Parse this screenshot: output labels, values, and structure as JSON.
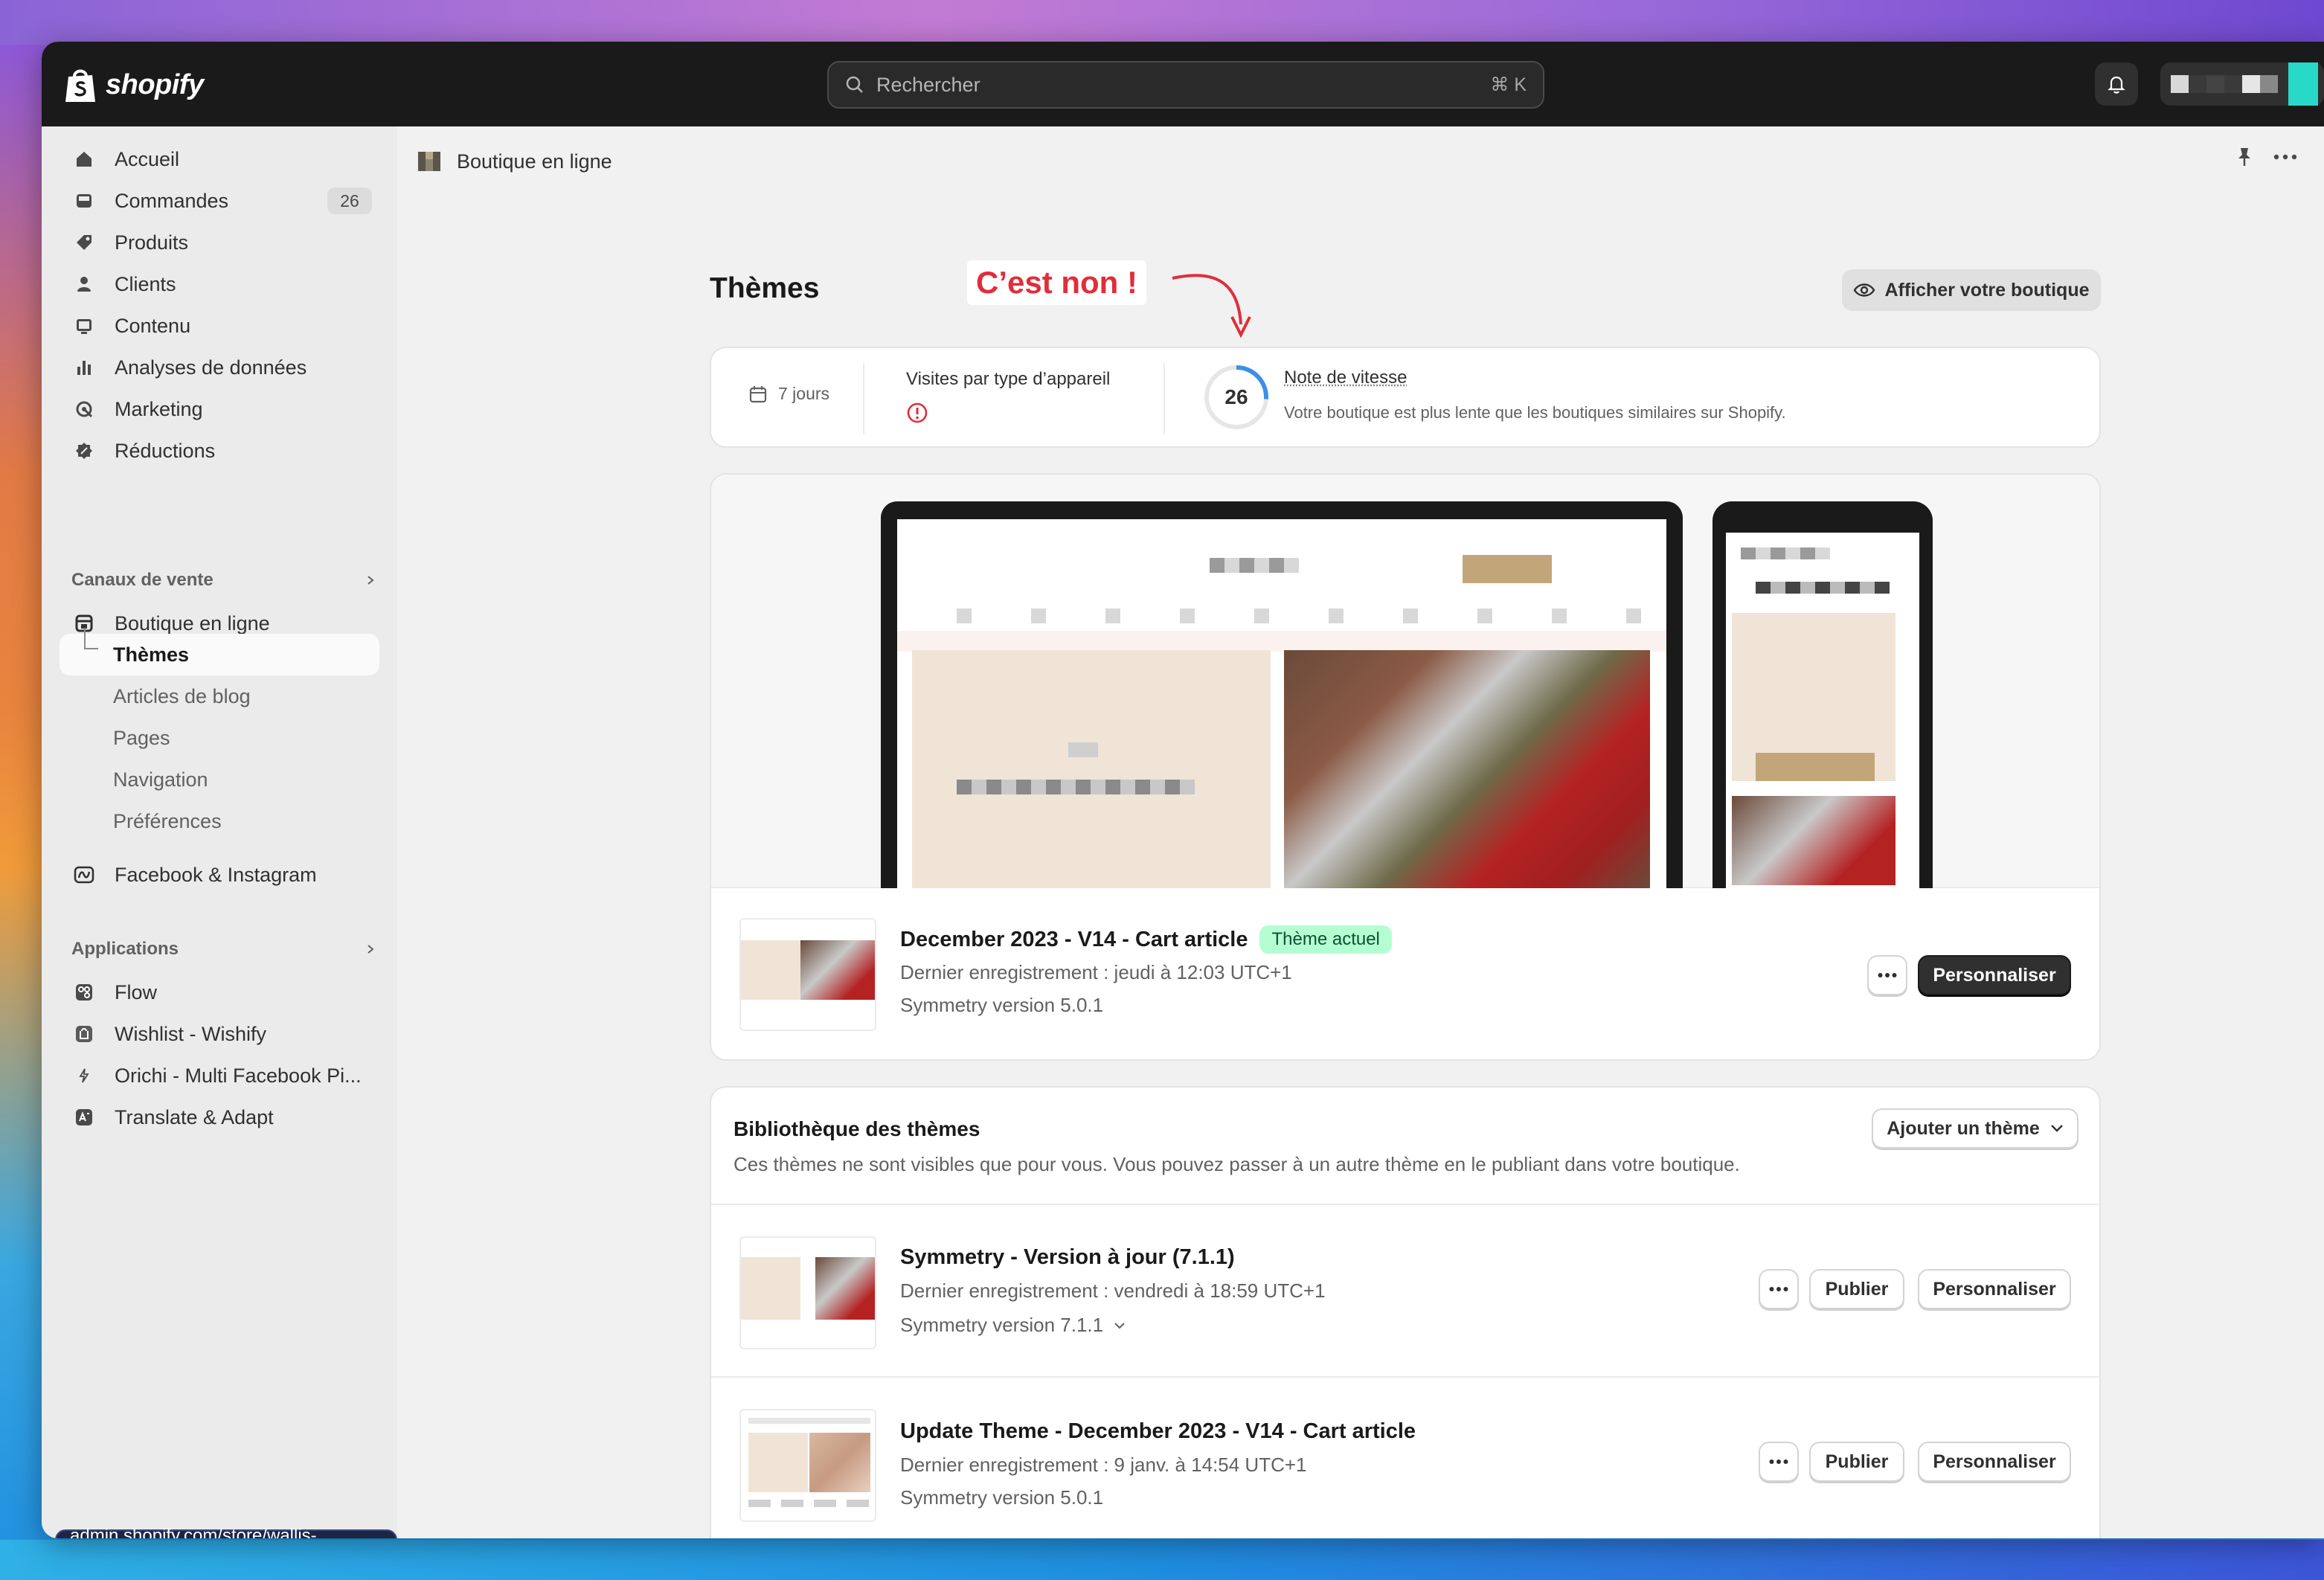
{
  "topbar": {
    "brand": "shopify",
    "search_placeholder": "Rechercher",
    "search_shortcut": "⌘ K"
  },
  "sidebar": {
    "main_items": [
      {
        "label": "Accueil",
        "icon": "home-icon"
      },
      {
        "label": "Commandes",
        "icon": "inbox-icon",
        "badge": "26"
      },
      {
        "label": "Produits",
        "icon": "tag-icon"
      },
      {
        "label": "Clients",
        "icon": "person-icon"
      },
      {
        "label": "Contenu",
        "icon": "image-icon"
      },
      {
        "label": "Analyses de données",
        "icon": "bar-chart-icon"
      },
      {
        "label": "Marketing",
        "icon": "target-icon"
      },
      {
        "label": "Réductions",
        "icon": "discount-icon"
      }
    ],
    "sales_channels_label": "Canaux de vente",
    "online_store": "Boutique en ligne",
    "online_store_sub": [
      "Thèmes",
      "Articles de blog",
      "Pages",
      "Navigation",
      "Préférences"
    ],
    "facebook": "Facebook & Instagram",
    "apps_label": "Applications",
    "apps": [
      "Flow",
      "Wishlist - Wishify",
      "Orichi - Multi Facebook Pi...",
      "Translate & Adapt"
    ],
    "status_url": "admin.shopify.com/store/wallis-paris/themes"
  },
  "header": {
    "breadcrumb": "Boutique en ligne",
    "title": "Thèmes",
    "view_store": "Afficher votre boutique",
    "annotation": "C’est non !"
  },
  "stats": {
    "period": "7 jours",
    "visits_label": "Visites par type d’appareil",
    "speed_score": "26",
    "speed_label": "Note de vitesse",
    "speed_desc": "Votre boutique est plus lente que les boutiques similaires sur Shopify.",
    "speed_fraction": 0.26
  },
  "current_theme": {
    "name": "December 2023 - V14 - Cart article",
    "badge": "Thème actuel",
    "saved": "Dernier enregistrement : jeudi à 12:03 UTC+1",
    "version": "Symmetry version 5.0.1",
    "customize": "Personnaliser"
  },
  "library": {
    "title": "Bibliothèque des thèmes",
    "desc": "Ces thèmes ne sont visibles que pour vous. Vous pouvez passer à un autre thème en le publiant dans votre boutique.",
    "add_theme": "Ajouter un thème",
    "themes": [
      {
        "name": "Symmetry - Version à jour (7.1.1)",
        "saved": "Dernier enregistrement : vendredi à 18:59 UTC+1",
        "version": "Symmetry version 7.1.1",
        "publish": "Publier",
        "customize": "Personnaliser"
      },
      {
        "name": "Update Theme - December 2023 - V14 - Cart article",
        "saved": "Dernier enregistrement : 9 janv. à 14:54 UTC+1",
        "version": "Symmetry version 5.0.1",
        "publish": "Publier",
        "customize": "Personnaliser"
      }
    ]
  },
  "colors": {
    "annotation": "#e12d3a",
    "speed_ring": "#3a8fe8",
    "badge_bg": "#b4fed2",
    "dark_button": "#303030",
    "warning": "#e12d3a"
  }
}
